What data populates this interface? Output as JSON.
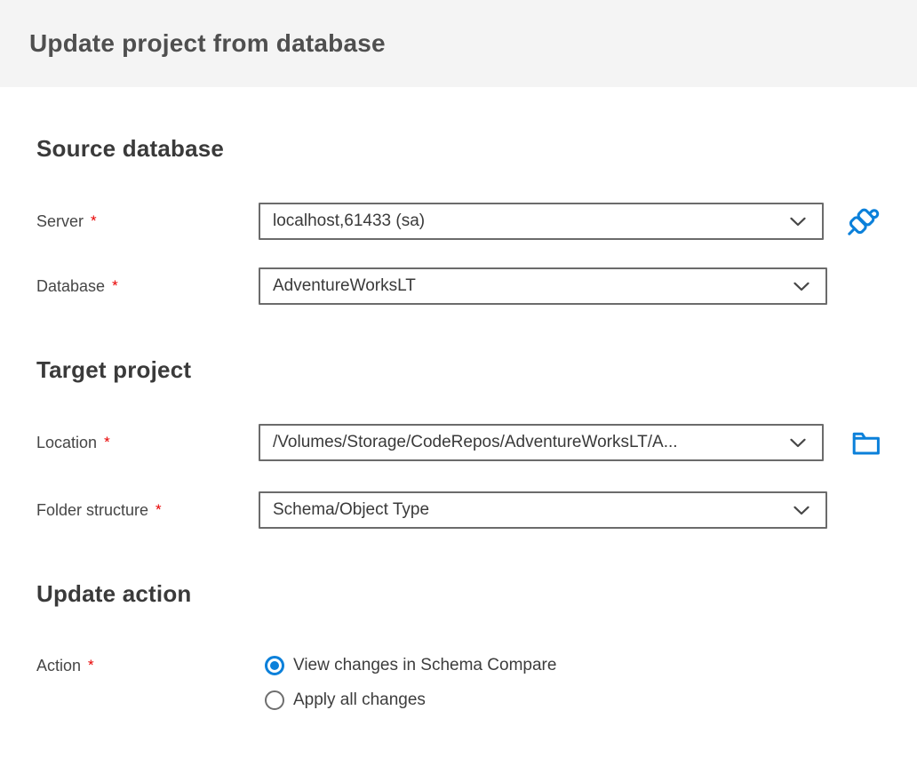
{
  "header": {
    "title": "Update project from database"
  },
  "required_marker": "*",
  "sections": {
    "source": {
      "title": "Source database"
    },
    "target": {
      "title": "Target project"
    },
    "update": {
      "title": "Update action"
    }
  },
  "fields": {
    "server": {
      "label": "Server",
      "value": "localhost,61433 (sa)"
    },
    "database": {
      "label": "Database",
      "value": "AdventureWorksLT"
    },
    "location": {
      "label": "Location",
      "value": "/Volumes/Storage/CodeRepos/AdventureWorksLT/A..."
    },
    "folder_structure": {
      "label": "Folder structure",
      "value": "Schema/Object Type"
    },
    "action": {
      "label": "Action"
    }
  },
  "action_options": {
    "view_changes": {
      "label": "View changes in Schema Compare",
      "selected": true
    },
    "apply_all": {
      "label": "Apply all changes",
      "selected": false
    }
  },
  "icons": {
    "connect": "connect-plug-icon",
    "browse_folder": "folder-icon",
    "dropdown": "chevron-down-icon"
  },
  "colors": {
    "accent_blue": "#0b80da",
    "required_red": "#e80000",
    "header_background": "#f4f4f4",
    "field_border": "#6b6b6b",
    "heading_text": "#3a3a3a"
  }
}
